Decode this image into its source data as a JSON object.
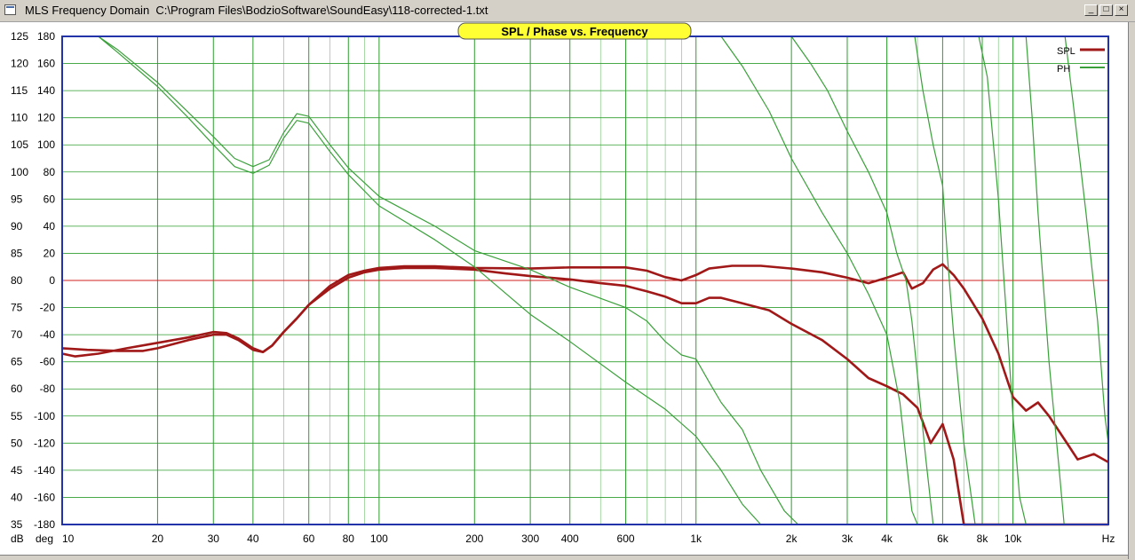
{
  "window": {
    "title": "MLS Frequency Domain  C:\\Program Files\\BodzioSoftware\\SoundEasy\\118-corrected-1.txt",
    "buttons": [
      "_",
      "□",
      "×"
    ]
  },
  "colors": {
    "spl": "#a01818",
    "phase": "#3aa03a",
    "grid_major": "#2e9e2e",
    "grid_minor": "#8fd08f",
    "frame": "#2233aa",
    "title_badge": "#ffff33",
    "zero_line": "#d02020"
  },
  "chart_data": {
    "type": "line",
    "title": "SPL / Phase vs. Frequency",
    "x_scale": "log",
    "xlim": [
      10,
      20000
    ],
    "x_ticks": [
      {
        "v": 10,
        "label": "10"
      },
      {
        "v": 20,
        "label": "20"
      },
      {
        "v": 30,
        "label": "30"
      },
      {
        "v": 40,
        "label": "40"
      },
      {
        "v": 60,
        "label": "60"
      },
      {
        "v": 80,
        "label": "80"
      },
      {
        "v": 100,
        "label": "100"
      },
      {
        "v": 200,
        "label": "200"
      },
      {
        "v": 300,
        "label": "300"
      },
      {
        "v": 400,
        "label": "400"
      },
      {
        "v": 600,
        "label": "600"
      },
      {
        "v": 1000,
        "label": "1k"
      },
      {
        "v": 2000,
        "label": "2k"
      },
      {
        "v": 3000,
        "label": "3k"
      },
      {
        "v": 4000,
        "label": "4k"
      },
      {
        "v": 6000,
        "label": "6k"
      },
      {
        "v": 8000,
        "label": "8k"
      },
      {
        "v": 10000,
        "label": "10k"
      }
    ],
    "x_unit_label": "Hz",
    "y_spl_label": "dB",
    "y_phase_label": "deg",
    "y_spl_ticks": [
      "35",
      "40",
      "45",
      "50",
      "55",
      "60",
      "65",
      "70",
      "75",
      "80",
      "85",
      "90",
      "95",
      "100",
      "105",
      "110",
      "115",
      "120",
      "125"
    ],
    "y_phase_ticks": [
      "-180",
      "-160",
      "-140",
      "-120",
      "-100",
      "-80",
      "-60",
      "-40",
      "-20",
      "0",
      "20",
      "40",
      "60",
      "80",
      "100",
      "120",
      "140",
      "160",
      "180"
    ],
    "spl_range": [
      35,
      125
    ],
    "phase_range": [
      -180,
      180
    ],
    "legend": [
      {
        "name": "SPL",
        "color": "#a01818"
      },
      {
        "name": "PH",
        "color": "#3aa03a"
      }
    ],
    "series": [
      {
        "name": "SPL",
        "color": "#a01818",
        "points": [
          [
            10,
            67.5
          ],
          [
            12,
            67.2
          ],
          [
            15,
            67.0
          ],
          [
            18,
            67.0
          ],
          [
            20,
            67.5
          ],
          [
            25,
            69.0
          ],
          [
            30,
            70.0
          ],
          [
            33,
            70.0
          ],
          [
            36,
            69.0
          ],
          [
            40,
            67.2
          ],
          [
            43,
            66.8
          ],
          [
            46,
            68.0
          ],
          [
            50,
            70.5
          ],
          [
            55,
            73.0
          ],
          [
            60,
            75.5
          ],
          [
            70,
            78.5
          ],
          [
            80,
            80.5
          ],
          [
            90,
            81.5
          ],
          [
            100,
            82.0
          ],
          [
            120,
            82.3
          ],
          [
            150,
            82.3
          ],
          [
            200,
            82.0
          ],
          [
            250,
            81.3
          ],
          [
            300,
            80.8
          ],
          [
            400,
            80.2
          ],
          [
            500,
            79.5
          ],
          [
            600,
            79.0
          ],
          [
            700,
            78.0
          ],
          [
            800,
            77.0
          ],
          [
            900,
            75.8
          ],
          [
            1000,
            75.8
          ],
          [
            1100,
            76.8
          ],
          [
            1200,
            76.8
          ],
          [
            1400,
            75.8
          ],
          [
            1700,
            74.5
          ],
          [
            2000,
            72.0
          ],
          [
            2500,
            69.0
          ],
          [
            3000,
            65.5
          ],
          [
            3500,
            62.0
          ],
          [
            4000,
            60.5
          ],
          [
            4500,
            59.0
          ],
          [
            5000,
            56.5
          ],
          [
            5500,
            50.0
          ],
          [
            6000,
            53.5
          ],
          [
            6500,
            47.0
          ],
          [
            7000,
            35.0
          ],
          [
            20000,
            35.0
          ]
        ]
      },
      {
        "name": "SPL",
        "color": "#a01818",
        "points": [
          [
            10,
            66.5
          ],
          [
            11,
            66.0
          ],
          [
            13,
            66.5
          ],
          [
            16,
            67.5
          ],
          [
            20,
            68.5
          ],
          [
            25,
            69.5
          ],
          [
            30,
            70.5
          ],
          [
            33,
            70.3
          ],
          [
            36,
            69.3
          ],
          [
            40,
            67.5
          ],
          [
            43,
            66.8
          ],
          [
            46,
            68.0
          ],
          [
            50,
            70.5
          ],
          [
            55,
            73.0
          ],
          [
            60,
            75.5
          ],
          [
            70,
            79.0
          ],
          [
            80,
            81.0
          ],
          [
            90,
            81.8
          ],
          [
            100,
            82.3
          ],
          [
            120,
            82.6
          ],
          [
            150,
            82.6
          ],
          [
            200,
            82.3
          ],
          [
            300,
            82.2
          ],
          [
            400,
            82.4
          ],
          [
            500,
            82.4
          ],
          [
            600,
            82.4
          ],
          [
            700,
            81.8
          ],
          [
            800,
            80.6
          ],
          [
            900,
            80.0
          ],
          [
            1000,
            81.0
          ],
          [
            1100,
            82.2
          ],
          [
            1300,
            82.7
          ],
          [
            1600,
            82.7
          ],
          [
            2000,
            82.2
          ],
          [
            2500,
            81.5
          ],
          [
            3000,
            80.5
          ],
          [
            3500,
            79.5
          ],
          [
            4000,
            80.5
          ],
          [
            4500,
            81.5
          ],
          [
            4800,
            78.5
          ],
          [
            5200,
            79.5
          ],
          [
            5600,
            82.0
          ],
          [
            6000,
            83.0
          ],
          [
            6500,
            81.0
          ],
          [
            7000,
            78.5
          ],
          [
            8000,
            73.0
          ],
          [
            9000,
            66.5
          ],
          [
            10000,
            58.5
          ],
          [
            11000,
            56.0
          ],
          [
            12000,
            57.5
          ],
          [
            13000,
            55.0
          ],
          [
            15000,
            49.5
          ],
          [
            16000,
            47.0
          ],
          [
            18000,
            48.0
          ],
          [
            20000,
            46.5
          ]
        ]
      },
      {
        "name": "PH",
        "color": "#3aa03a",
        "points": [
          [
            13,
            180
          ],
          [
            15,
            168
          ],
          [
            20,
            143
          ],
          [
            25,
            120
          ],
          [
            30,
            100
          ],
          [
            35,
            84
          ],
          [
            40,
            79
          ],
          [
            45,
            85
          ],
          [
            50,
            105
          ],
          [
            55,
            118
          ],
          [
            60,
            116
          ],
          [
            70,
            95
          ],
          [
            80,
            78
          ],
          [
            100,
            55
          ],
          [
            150,
            30
          ],
          [
            200,
            10
          ],
          [
            300,
            -25
          ],
          [
            400,
            -45
          ],
          [
            600,
            -75
          ],
          [
            800,
            -95
          ],
          [
            1000,
            -115
          ],
          [
            1200,
            -140
          ],
          [
            1400,
            -165
          ],
          [
            1600,
            -180
          ]
        ]
      },
      {
        "name": "PH",
        "color": "#3aa03a",
        "points": [
          [
            13,
            180
          ],
          [
            15,
            170
          ],
          [
            20,
            146
          ],
          [
            25,
            124
          ],
          [
            30,
            106
          ],
          [
            35,
            90
          ],
          [
            40,
            84
          ],
          [
            45,
            89
          ],
          [
            50,
            109
          ],
          [
            55,
            123
          ],
          [
            60,
            121
          ],
          [
            70,
            100
          ],
          [
            80,
            83
          ],
          [
            100,
            62
          ],
          [
            150,
            40
          ],
          [
            200,
            22
          ],
          [
            300,
            8
          ],
          [
            400,
            -5
          ],
          [
            600,
            -20
          ],
          [
            700,
            -30
          ],
          [
            800,
            -45
          ],
          [
            900,
            -55
          ],
          [
            1000,
            -58
          ],
          [
            1100,
            -75
          ],
          [
            1200,
            -90
          ],
          [
            1400,
            -110
          ],
          [
            1600,
            -140
          ],
          [
            1900,
            -170
          ],
          [
            2100,
            -180
          ]
        ]
      },
      {
        "name": "PH",
        "color": "#3aa03a",
        "points": [
          [
            1200,
            180
          ],
          [
            1400,
            158
          ],
          [
            1700,
            125
          ],
          [
            2000,
            90
          ],
          [
            2500,
            50
          ],
          [
            3000,
            20
          ],
          [
            3500,
            -10
          ],
          [
            4000,
            -40
          ],
          [
            4400,
            -90
          ],
          [
            4800,
            -170
          ],
          [
            5000,
            -180
          ]
        ]
      },
      {
        "name": "PH",
        "color": "#3aa03a",
        "points": [
          [
            2000,
            180
          ],
          [
            2300,
            160
          ],
          [
            2600,
            140
          ],
          [
            3000,
            110
          ],
          [
            3500,
            80
          ],
          [
            4000,
            50
          ],
          [
            4300,
            20
          ],
          [
            4600,
            0
          ],
          [
            4800,
            -30
          ],
          [
            5000,
            -70
          ],
          [
            5300,
            -130
          ],
          [
            5600,
            -180
          ]
        ]
      },
      {
        "name": "PH",
        "color": "#3aa03a",
        "points": [
          [
            4900,
            180
          ],
          [
            5200,
            140
          ],
          [
            5600,
            100
          ],
          [
            6000,
            70
          ],
          [
            6200,
            20
          ],
          [
            6500,
            -40
          ],
          [
            7000,
            -120
          ],
          [
            7600,
            -180
          ]
        ]
      },
      {
        "name": "PH",
        "color": "#3aa03a",
        "points": [
          [
            7800,
            180
          ],
          [
            8300,
            150
          ],
          [
            9000,
            60
          ],
          [
            9500,
            -20
          ],
          [
            10000,
            -100
          ],
          [
            10500,
            -160
          ],
          [
            11000,
            -180
          ]
        ]
      },
      {
        "name": "PH",
        "color": "#3aa03a",
        "points": [
          [
            11000,
            180
          ],
          [
            11500,
            120
          ],
          [
            12000,
            50
          ],
          [
            13000,
            -60
          ],
          [
            14000,
            -140
          ],
          [
            14500,
            -180
          ]
        ]
      },
      {
        "name": "PH",
        "color": "#3aa03a",
        "points": [
          [
            14600,
            180
          ],
          [
            15500,
            130
          ],
          [
            17000,
            50
          ],
          [
            18500,
            -30
          ],
          [
            19500,
            -100
          ],
          [
            20000,
            -120
          ]
        ]
      }
    ]
  }
}
